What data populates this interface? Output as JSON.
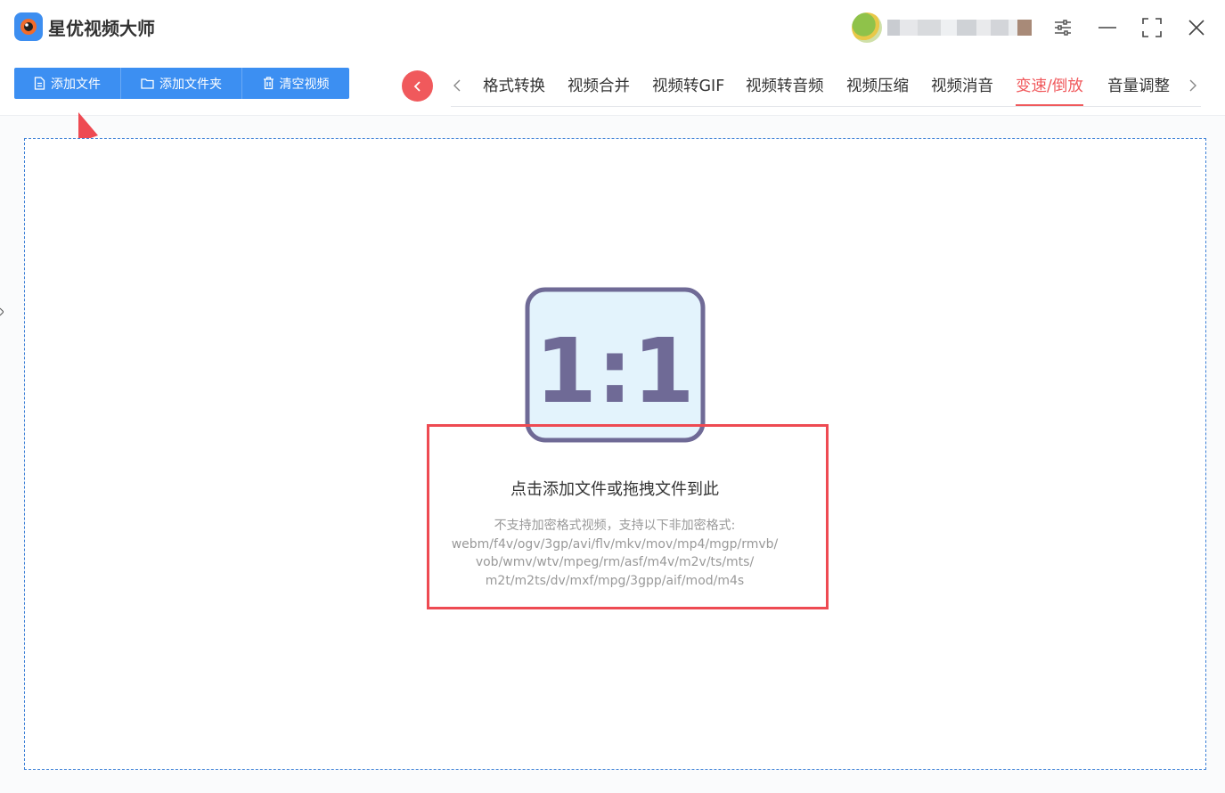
{
  "app": {
    "title": "星优视频大师"
  },
  "toolbar": {
    "buttons": [
      {
        "label": "添加文件",
        "icon": "file-icon"
      },
      {
        "label": "添加文件夹",
        "icon": "folder-icon"
      },
      {
        "label": "清空视频",
        "icon": "trash-icon"
      }
    ]
  },
  "tabs": [
    {
      "label": "格式转换"
    },
    {
      "label": "视频合并"
    },
    {
      "label": "视频转GIF"
    },
    {
      "label": "视频转音频"
    },
    {
      "label": "视频压缩"
    },
    {
      "label": "视频消音"
    },
    {
      "label": "变速/倒放",
      "active": true
    },
    {
      "label": "音量调整"
    }
  ],
  "dropzone": {
    "icon_text": "1:1",
    "title": "点击添加文件或拖拽文件到此",
    "hint_lines": [
      "不支持加密格式视频，支持以下非加密格式:",
      "webm/f4v/ogv/3gp/avi/flv/mkv/mov/mp4/mgp/rmvb/",
      "vob/wmv/wtv/mpeg/rm/asf/m4v/m2v/ts/mts/",
      "m2t/m2ts/dv/mxf/mpg/3gpp/aif/mod/m4s"
    ]
  },
  "colors": {
    "accent_blue": "#3c8ff2",
    "accent_red": "#f0595c",
    "annotation_red": "#ee4a52",
    "icon_frame": "#6f6a96",
    "icon_fill": "#e3f3fc"
  }
}
